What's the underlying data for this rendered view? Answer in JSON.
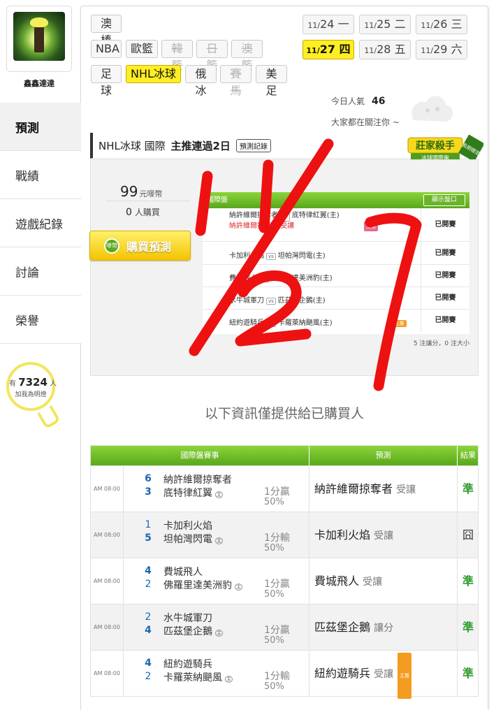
{
  "user": {
    "name": "鑫鑫達達"
  },
  "sidebar": {
    "items": [
      {
        "label": "預測",
        "active": true
      },
      {
        "label": "戰績"
      },
      {
        "label": "遊戲紀錄"
      },
      {
        "label": "討論"
      },
      {
        "label": "榮譽"
      }
    ]
  },
  "light_bulb": {
    "prefix": "有",
    "count": "7324",
    "suffix": "人",
    "sub": "加我為明燈"
  },
  "leagues": {
    "row1": [
      {
        "label": "澳棒",
        "state": "normal"
      }
    ],
    "row2": [
      {
        "label": "NBA",
        "state": "normal"
      },
      {
        "label": "歐籃",
        "state": "normal"
      },
      {
        "label": "韓籃",
        "state": "disabled"
      },
      {
        "label": "日籃",
        "state": "disabled"
      },
      {
        "label": "澳籃",
        "state": "disabled"
      }
    ],
    "row3": [
      {
        "label": "足球",
        "state": "normal"
      },
      {
        "label": "NHL冰球",
        "state": "active"
      },
      {
        "label": "俄冰",
        "state": "normal"
      },
      {
        "label": "賽馬",
        "state": "disabled"
      },
      {
        "label": "美足",
        "state": "normal"
      }
    ]
  },
  "dates": [
    {
      "month": "11/",
      "day": "24",
      "weekday": "一",
      "active": false
    },
    {
      "month": "11/",
      "day": "25",
      "weekday": "二",
      "active": false
    },
    {
      "month": "11/",
      "day": "26",
      "weekday": "三",
      "active": false
    },
    {
      "month": "11/",
      "day": "27",
      "weekday": "四",
      "active": true
    },
    {
      "month": "11/",
      "day": "28",
      "weekday": "五",
      "active": false
    },
    {
      "month": "11/",
      "day": "29",
      "weekday": "六",
      "active": false
    }
  ],
  "popularity": {
    "label": "今日人氣",
    "value": "46",
    "watching": "大家都在關注你 ~"
  },
  "title_bar": {
    "league": "NHL冰球",
    "market": "國際",
    "streak": "主推連過2日",
    "record_button": "預測記錄"
  },
  "badge": {
    "main": "莊家殺手",
    "sub": "冰球國際盤",
    "ribbon": "長期穩定"
  },
  "purchase": {
    "price": "99",
    "price_unit": "元嘜幣",
    "buyers": "0",
    "buyers_unit": "人購買",
    "buy_button": "購買預測",
    "coin_label": "嘜幣"
  },
  "preview": {
    "header": "國際盤",
    "show_button": "顯示盤口",
    "rows": [
      {
        "away": "納許維爾掠奪者",
        "home": "底特律紅翼(主)",
        "pick": "納許維爾掠奪者",
        "handicap": "受讓",
        "status": "已開賽",
        "tag": "主推"
      },
      {
        "away": "卡加利火焰",
        "home": "坦帕灣閃電(主)",
        "status": "已開賽"
      },
      {
        "away": "費城飛人",
        "home": "佛羅里達美洲豹(主)",
        "status": "已開賽"
      },
      {
        "away": "水牛城軍刀",
        "home": "匹茲堡企鵝(主)",
        "status": "已開賽"
      },
      {
        "away": "紐約遊騎兵",
        "home": "卡羅萊納颶風(主)",
        "status": "已開賽",
        "tag": "主推"
      }
    ],
    "footer": "5 注讓分，0 注大小"
  },
  "info_text": "以下資訊僅提供給已購買人",
  "results": {
    "headers": {
      "game": "國際盤賽事",
      "prediction": "預測",
      "result": "結果"
    },
    "host_mark": "主",
    "rows": [
      {
        "time": "AM 08:00",
        "away_score": "6",
        "home_score": "3",
        "away": "納許維爾掠奪者",
        "home": "底特律紅翼",
        "outcome": "1分贏",
        "pct": "50%",
        "pick": "納許維爾掠奪者",
        "pick_type": "受讓",
        "tag": "",
        "result": "準",
        "win": true
      },
      {
        "time": "AM 08:00",
        "away_score": "1",
        "home_score": "5",
        "away": "卡加利火焰",
        "home": "坦帕灣閃電",
        "outcome": "1分輸",
        "pct": "50%",
        "pick": "卡加利火焰",
        "pick_type": "受讓",
        "tag": "",
        "result": "囧",
        "win": false
      },
      {
        "time": "AM 08:00",
        "away_score": "4",
        "home_score": "2",
        "away": "費城飛人",
        "home": "佛羅里達美洲豹",
        "outcome": "1分贏",
        "pct": "50%",
        "pick": "費城飛人",
        "pick_type": "受讓",
        "tag": "",
        "result": "準",
        "win": true
      },
      {
        "time": "AM 08:00",
        "away_score": "2",
        "home_score": "4",
        "away": "水牛城軍刀",
        "home": "匹茲堡企鵝",
        "outcome": "1分贏",
        "pct": "50%",
        "pick": "匹茲堡企鵝",
        "pick_type": "讓分",
        "tag": "",
        "result": "準",
        "win": true
      },
      {
        "time": "AM 08:00",
        "away_score": "4",
        "home_score": "2",
        "away": "紐約遊騎兵",
        "home": "卡羅萊納颶風",
        "outcome": "1分輸",
        "pct": "50%",
        "pick": "紐約遊騎兵",
        "pick_type": "受讓",
        "tag": "主推",
        "result": "準",
        "win": true
      }
    ]
  },
  "colors": {
    "green": "#58a81c",
    "yellow": "#ffee22",
    "scribble": "#ee1111",
    "win": "#2e9b2e",
    "score_blue": "#1a67b0"
  }
}
